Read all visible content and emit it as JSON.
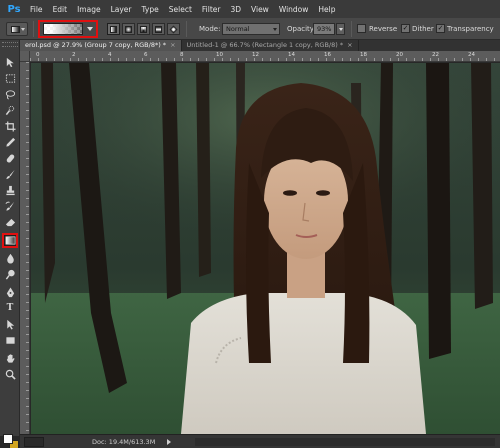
{
  "app": {
    "logo": "Ps",
    "menu": [
      "File",
      "Edit",
      "Image",
      "Layer",
      "Type",
      "Select",
      "Filter",
      "3D",
      "View",
      "Window",
      "Help"
    ]
  },
  "options_bar": {
    "tool_preset_icon": "gradient-tool-icon",
    "gradient_picker_icon": "gradient-preview",
    "gradient_types": [
      "linear",
      "radial",
      "angle",
      "reflected",
      "diamond"
    ],
    "selected_gradient_type": "linear",
    "mode_label": "Mode:",
    "mode_value": "Normal",
    "opacity_label": "Opacity:",
    "opacity_value": "93%",
    "reverse_label": "Reverse",
    "reverse_checked": false,
    "dither_label": "Dither",
    "dither_checked": true,
    "transparency_label": "Transparency",
    "transparency_checked": true,
    "highlight_color": "#e01010"
  },
  "tabs": [
    {
      "label": "erol.psd @ 27.9% (Group 7 copy, RGB/8*) *",
      "active": true,
      "close": "×"
    },
    {
      "label": "Untitled-1 @ 66.7% (Rectangle 1 copy, RGB/8) *",
      "active": false,
      "close": "×"
    }
  ],
  "ruler": {
    "top_numbers": [
      "0",
      "2",
      "4",
      "6",
      "8",
      "10",
      "12",
      "14",
      "16",
      "18",
      "20",
      "22",
      "24"
    ]
  },
  "toolbox": {
    "tools": [
      "move-icon",
      "marquee-icon",
      "lasso-icon",
      "quick-select-icon",
      "crop-icon",
      "eyedropper-icon",
      "healing-brush-icon",
      "brush-icon",
      "clone-stamp-icon",
      "history-brush-icon",
      "eraser-icon",
      "gradient-icon",
      "blur-icon",
      "dodge-icon",
      "pen-icon",
      "type-icon",
      "path-select-icon",
      "rectangle-icon",
      "hand-icon",
      "zoom-icon"
    ],
    "selected_tool": "gradient-icon",
    "foreground_color": "#ffffff",
    "background_color": "#d2a520"
  },
  "status": {
    "doc_info": "Doc: 19.4M/613.3M"
  }
}
